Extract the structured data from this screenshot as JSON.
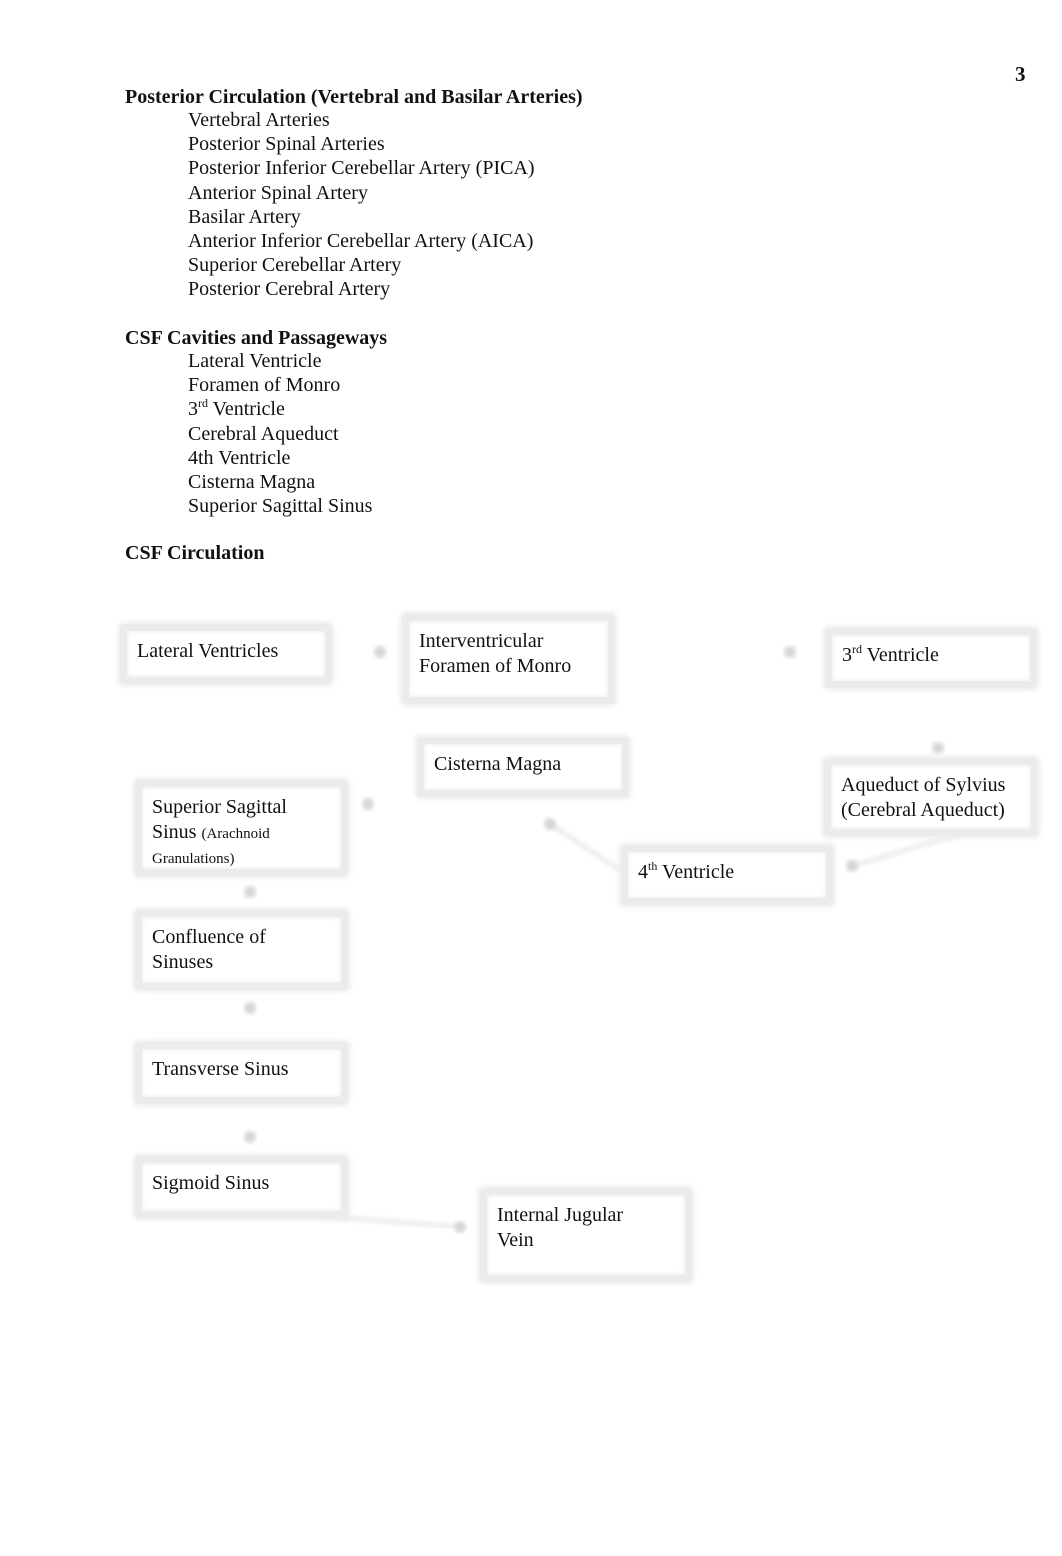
{
  "page_number": "3",
  "sections": [
    {
      "heading": "Posterior Circulation (Vertebral and Basilar Arteries)",
      "items": [
        "Vertebral Arteries",
        "Posterior Spinal Arteries",
        "Posterior Inferior Cerebellar Artery (PICA)",
        "Anterior Spinal Artery",
        "Basilar Artery",
        "Anterior Inferior Cerebellar Artery (AICA)",
        "Superior Cerebellar Artery",
        "Posterior Cerebral Artery"
      ]
    },
    {
      "heading": "CSF Cavities and Passageways",
      "items": [
        "Lateral Ventricle",
        "Foramen of Monro",
        {
          "base": "3",
          "sup": "rd",
          "rest": " Ventricle"
        },
        "Cerebral Aqueduct",
        "4th Ventricle",
        "Cisterna Magna",
        "Superior Sagittal Sinus"
      ]
    },
    {
      "heading": "CSF Circulation",
      "items": []
    }
  ],
  "flowchart": {
    "nodes": {
      "lateral_ventricles": {
        "line1": "Lateral Ventricles"
      },
      "foramen_monro": {
        "line1": "Interventricular",
        "line2": "Foramen of Monro"
      },
      "third_ventricle": {
        "base": "3",
        "sup": "rd",
        "rest": " Ventricle"
      },
      "aqueduct": {
        "line1": "Aqueduct of Sylvius",
        "line2": "(Cerebral Aqueduct)"
      },
      "fourth_ventricle": {
        "base": "4",
        "sup": "th",
        "rest": " Ventricle"
      },
      "cisterna_magna": {
        "line1": "Cisterna Magna"
      },
      "superior_sagittal_sinus": {
        "line1": "Superior Sagittal",
        "line2": "Sinus",
        "note": "(Arachnoid Granulations)"
      },
      "confluence": {
        "line1": "Confluence of",
        "line2": "Sinuses"
      },
      "transverse_sinus": {
        "line1": "Transverse Sinus"
      },
      "sigmoid_sinus": {
        "line1": "Sigmoid Sinus"
      },
      "internal_jugular": {
        "line1": "Internal Jugular",
        "line2": "Vein"
      }
    },
    "edges": [
      [
        "lateral_ventricles",
        "foramen_monro"
      ],
      [
        "foramen_monro",
        "third_ventricle"
      ],
      [
        "third_ventricle",
        "aqueduct"
      ],
      [
        "aqueduct",
        "fourth_ventricle"
      ],
      [
        "fourth_ventricle",
        "cisterna_magna"
      ],
      [
        "cisterna_magna",
        "superior_sagittal_sinus"
      ],
      [
        "superior_sagittal_sinus",
        "confluence"
      ],
      [
        "confluence",
        "transverse_sinus"
      ],
      [
        "transverse_sinus",
        "sigmoid_sinus"
      ],
      [
        "sigmoid_sinus",
        "internal_jugular"
      ]
    ]
  }
}
